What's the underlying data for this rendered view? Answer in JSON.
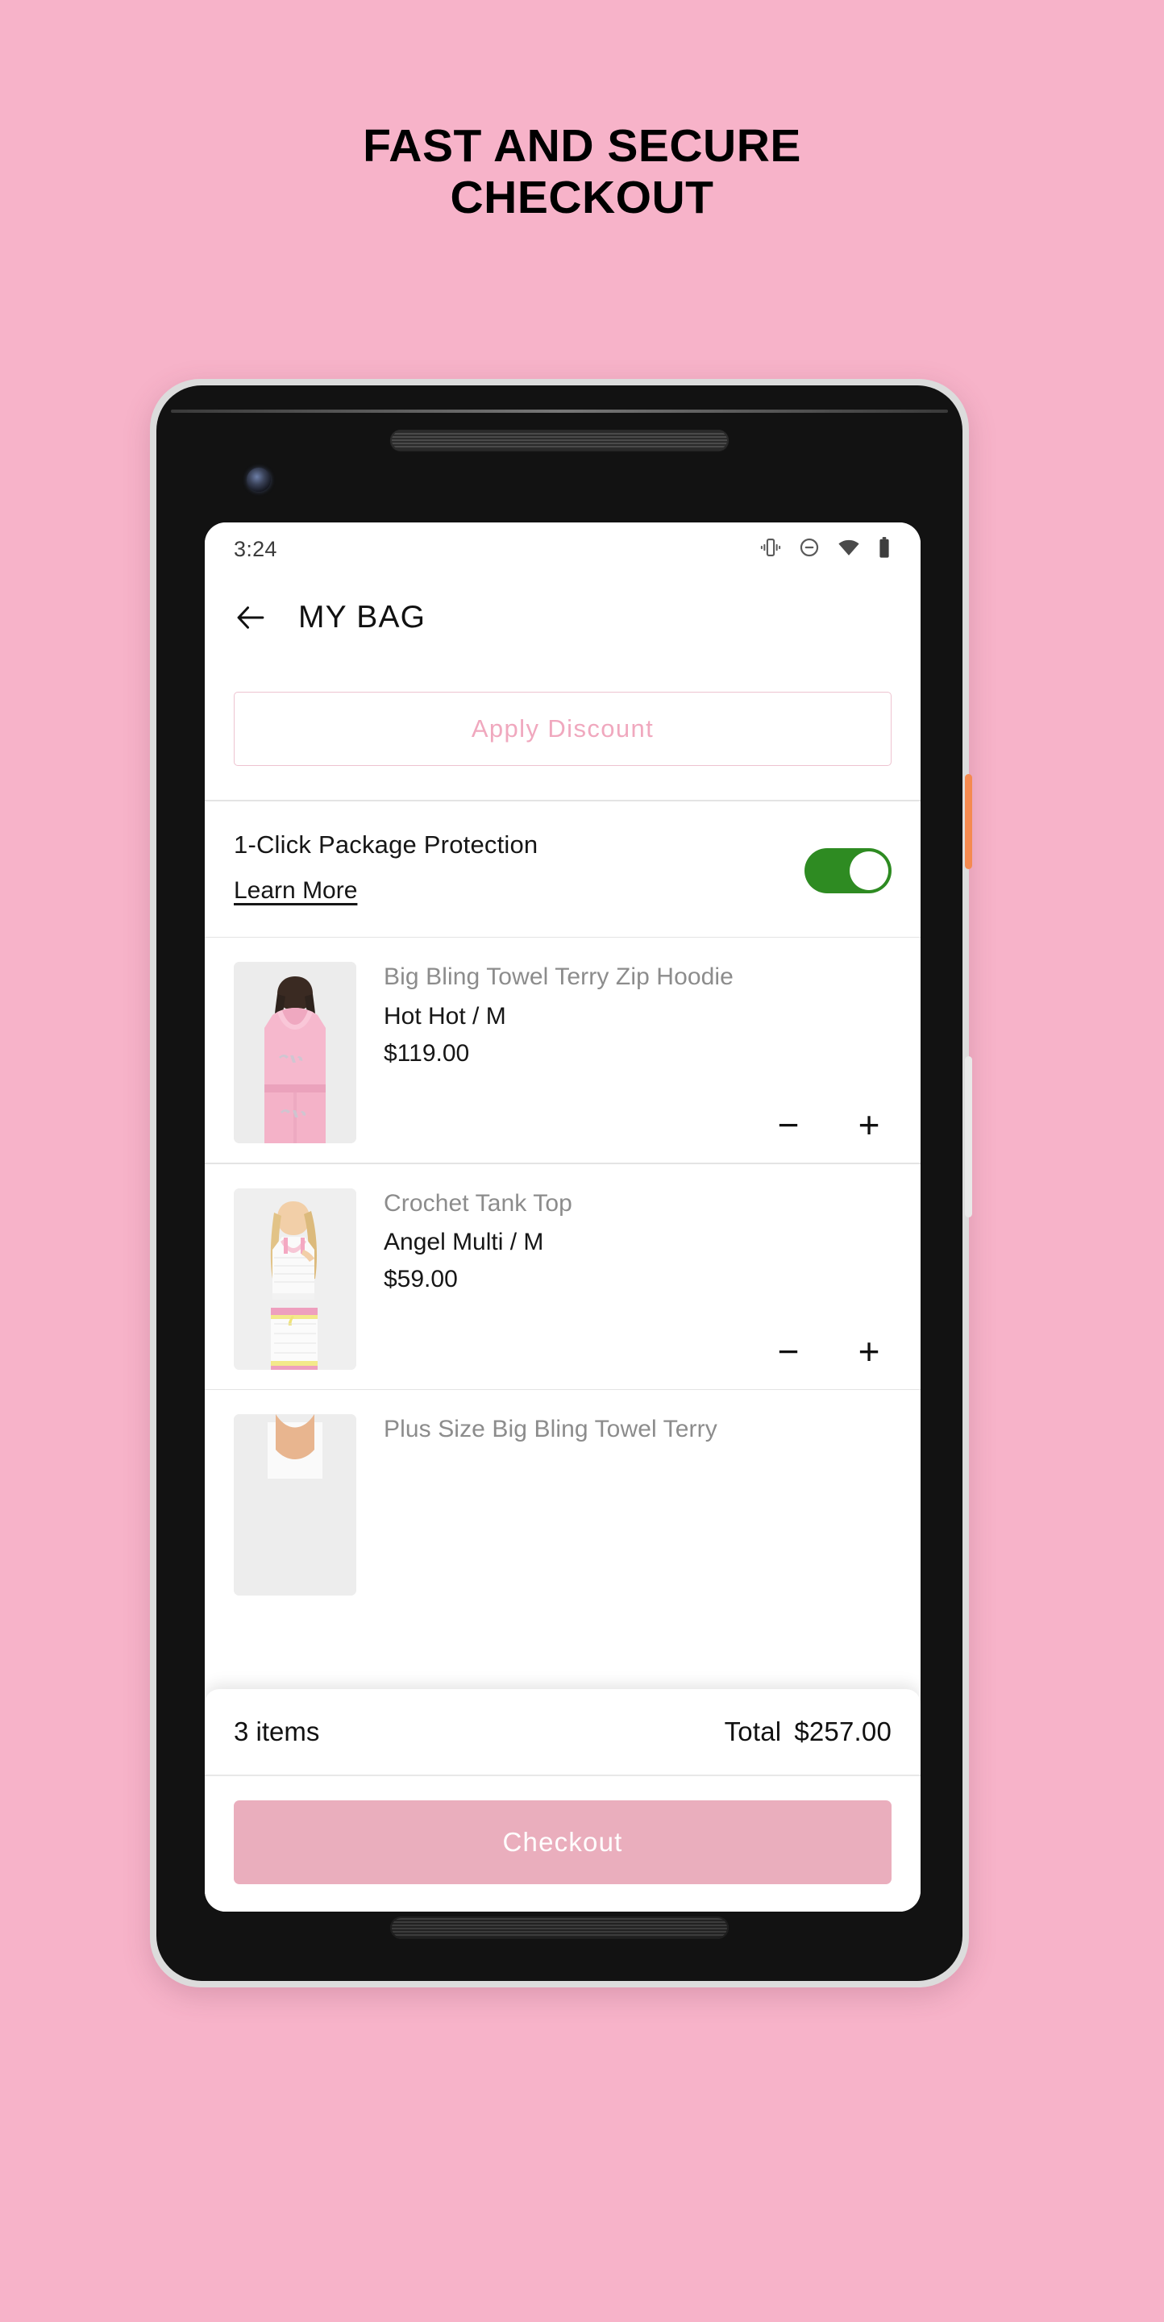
{
  "promo": {
    "headline_line1": "FAST AND SECURE",
    "headline_line2": "CHECKOUT",
    "background_color": "#F7B3C9",
    "headline_color": "#000000"
  },
  "device": {
    "hardware": {
      "power_button_color": "#F58A50",
      "volume_button_color": "#E9E9E9",
      "frame_color": "#121212"
    }
  },
  "statusbar": {
    "time": "3:24",
    "icons": [
      "vibrate-icon",
      "do-not-disturb-icon",
      "wifi-icon",
      "battery-icon"
    ]
  },
  "appbar": {
    "back_label": "Back",
    "title": "MY BAG"
  },
  "discount": {
    "label": "Apply Discount",
    "text_color": "#F0A8BE",
    "border_color": "#EEC3D0"
  },
  "protection": {
    "title": "1-Click Package Protection",
    "link_label": "Learn More",
    "toggle_on": true,
    "toggle_color": "#2E8B22"
  },
  "cart": {
    "items": [
      {
        "name": "Big Bling Towel Terry Zip Hoodie",
        "variant": "Hot Hot / M",
        "price": "$119.00",
        "decrease_label": "−",
        "increase_label": "+",
        "thumb": "pink-velour-hoodie-back-view"
      },
      {
        "name": "Crochet Tank Top",
        "variant": "Angel Multi / M",
        "price": "$59.00",
        "decrease_label": "−",
        "increase_label": "+",
        "thumb": "white-crochet-tank-and-skirt"
      },
      {
        "name": "Plus Size Big Bling Towel Terry",
        "variant": "",
        "price": "",
        "decrease_label": "−",
        "increase_label": "+",
        "thumb": "partially-hidden-product"
      }
    ]
  },
  "footer": {
    "items_count_label": "3 items",
    "total_label": "Total",
    "total_value": "$257.00",
    "checkout_label": "Checkout",
    "checkout_color": "#EAAEBD"
  }
}
